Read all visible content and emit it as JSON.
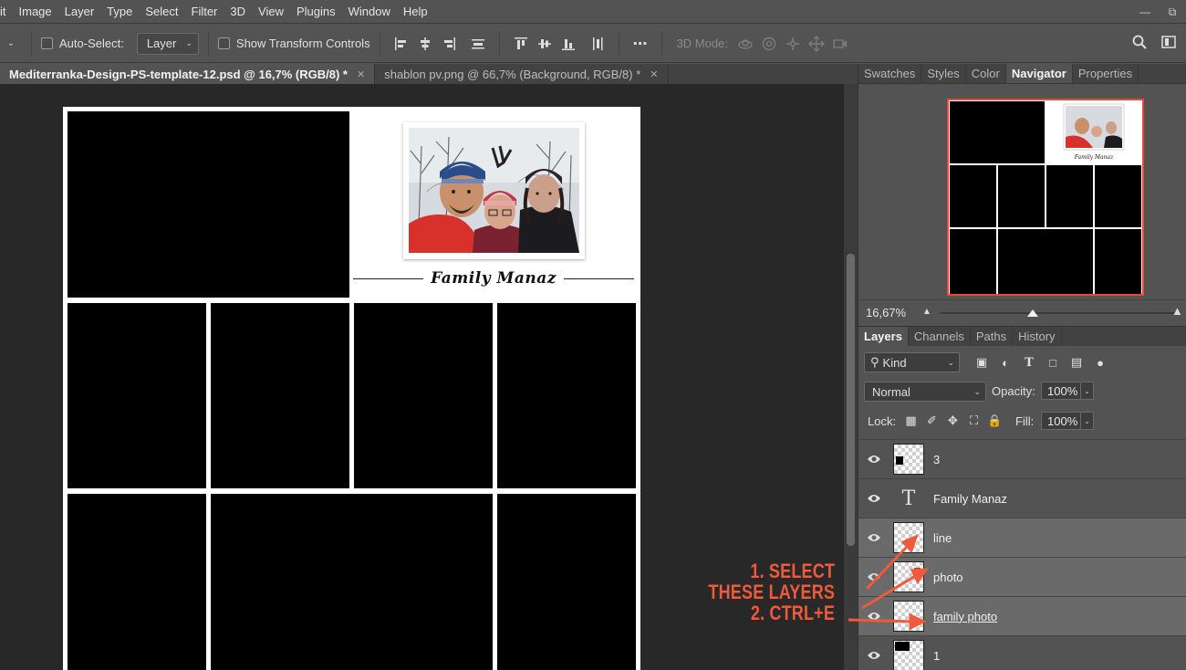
{
  "menubar": {
    "items": [
      "it",
      "Image",
      "Layer",
      "Type",
      "Select",
      "Filter",
      "3D",
      "View",
      "Plugins",
      "Window",
      "Help"
    ]
  },
  "options": {
    "auto_select_label": "Auto-Select:",
    "auto_select_target": "Layer",
    "show_transform_label": "Show Transform Controls",
    "mode_3d_label": "3D Mode:"
  },
  "doc_tabs": [
    {
      "label": "Mediterranka-Design-PS-template-12.psd @ 16,7% (RGB/8) *",
      "active": true
    },
    {
      "label": "shablon pv.png @ 66,7% (Background, RGB/8) *",
      "active": false
    }
  ],
  "canvas": {
    "caption": "Family Manaz"
  },
  "annotation": {
    "line1": "1. SELECT",
    "line2": "THESE LAYERS",
    "line3": "2. CTRL+E",
    "color": "#ef5a3c"
  },
  "top_panel_tabs": [
    "Swatches",
    "Styles",
    "Color",
    "Navigator",
    "Properties"
  ],
  "navigator": {
    "zoom": "16,67%",
    "highlight_color": "#e8473a"
  },
  "layers_panel": {
    "tabs": [
      "Layers",
      "Channels",
      "Paths",
      "History"
    ],
    "kind_label": "Kind",
    "blend_mode": "Normal",
    "opacity_label": "Opacity:",
    "opacity_value": "100%",
    "lock_label": "Lock:",
    "fill_label": "Fill:",
    "fill_value": "100%",
    "layers": [
      {
        "name": "3",
        "type": "pixel",
        "selected": false
      },
      {
        "name": "Family Manaz",
        "type": "text",
        "selected": false
      },
      {
        "name": "line",
        "type": "pixel",
        "selected": true
      },
      {
        "name": "photo",
        "type": "pixel",
        "selected": true
      },
      {
        "name": "family photo",
        "type": "pixel",
        "selected": true
      },
      {
        "name": "1",
        "type": "pixel",
        "selected": false
      }
    ]
  }
}
